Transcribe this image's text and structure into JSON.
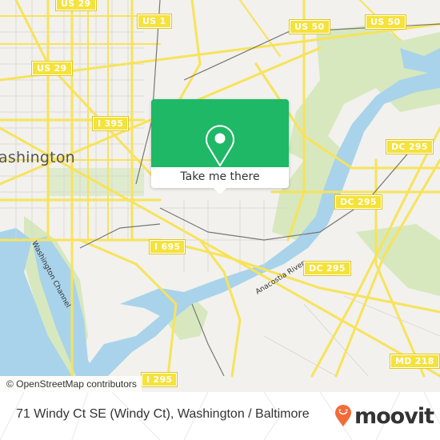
{
  "map": {
    "city_label": "ashington",
    "water_labels": {
      "channel": "Washington Channel",
      "river": "Anacostia River"
    },
    "route_shields": [
      {
        "id": "us29-top",
        "label": "US 29"
      },
      {
        "id": "us1",
        "label": "US 1"
      },
      {
        "id": "us50-left",
        "label": "US 50"
      },
      {
        "id": "us50-right",
        "label": "US 50"
      },
      {
        "id": "us29-mid",
        "label": "US 29"
      },
      {
        "id": "i395",
        "label": "I 395"
      },
      {
        "id": "dc295-top",
        "label": "DC 295"
      },
      {
        "id": "dc295-mid",
        "label": "DC 295"
      },
      {
        "id": "dc295-low",
        "label": "DC 295"
      },
      {
        "id": "i695",
        "label": "I 695"
      },
      {
        "id": "md218",
        "label": "MD 218"
      },
      {
        "id": "i295",
        "label": "I 295"
      }
    ],
    "attribution": "© OpenStreetMap contributors",
    "colors": {
      "land": "#f2f1ed",
      "water": "#a9d3ea",
      "park": "#d7e8bf",
      "road": "#f7e35a",
      "rail": "#777777"
    }
  },
  "popup": {
    "icon": "location-pin-icon",
    "action_label": "Take me there",
    "color": "#1fb866"
  },
  "footer": {
    "title": "71 Windy Ct SE (Windy Ct), Washington / Baltimore",
    "brand": "moovit",
    "brand_color": "#f26b38"
  }
}
